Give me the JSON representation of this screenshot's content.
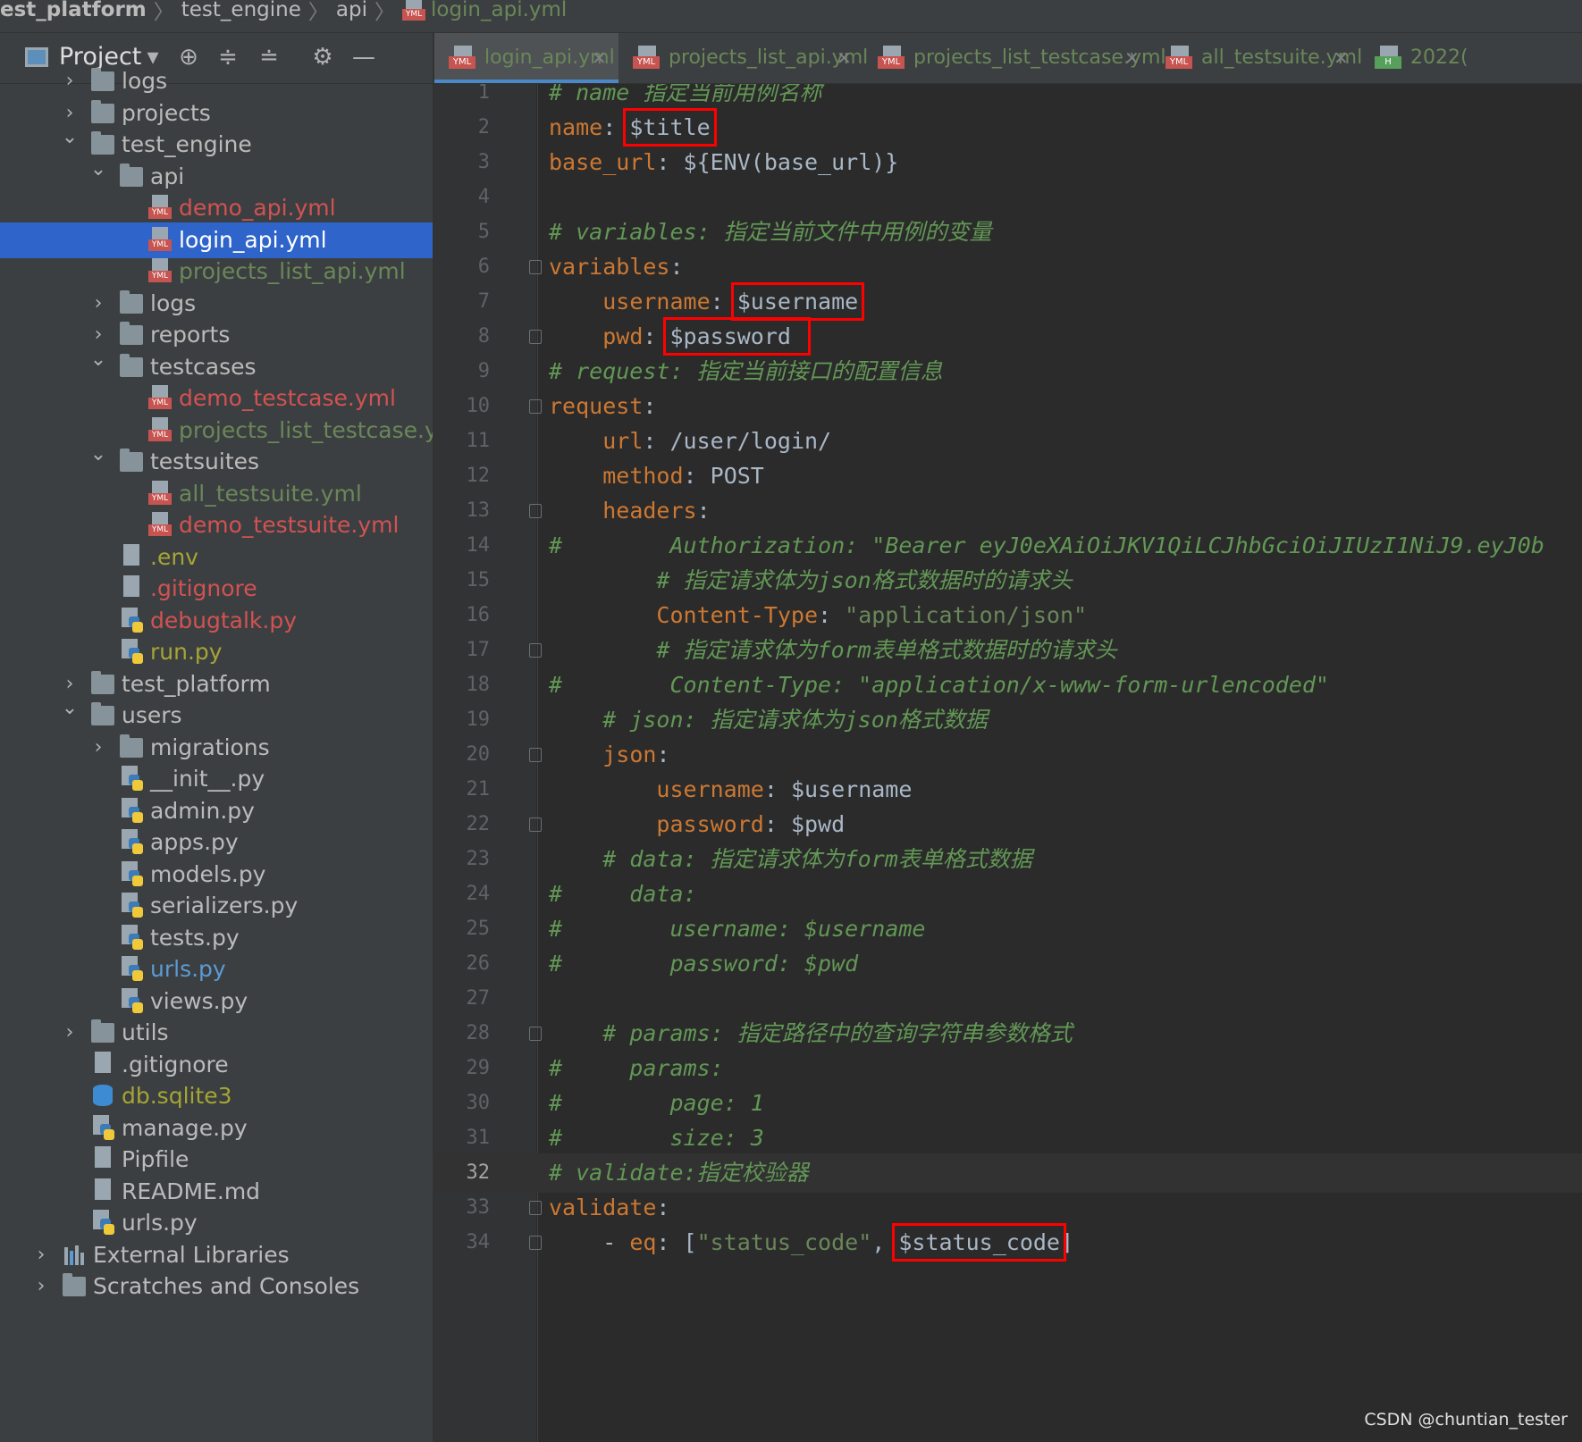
{
  "breadcrumb": [
    "est_platform",
    "test_engine",
    "api",
    "login_api.yml"
  ],
  "project_panel": {
    "title": "Project",
    "header_icons": [
      "dropdown-icon",
      "locate-icon",
      "expand-all-icon",
      "collapse-all-icon",
      "gear-icon",
      "minimize-icon"
    ]
  },
  "tree": [
    {
      "label": "logs",
      "type": "folder",
      "depth": 1,
      "expanded": false,
      "color": "default"
    },
    {
      "label": "projects",
      "type": "folder",
      "depth": 1,
      "expanded": false,
      "color": "default"
    },
    {
      "label": "test_engine",
      "type": "folder",
      "depth": 1,
      "expanded": true,
      "color": "default"
    },
    {
      "label": "api",
      "type": "folder",
      "depth": 2,
      "expanded": true,
      "color": "default"
    },
    {
      "label": "demo_api.yml",
      "type": "yml",
      "depth": 3,
      "color": "red"
    },
    {
      "label": "login_api.yml",
      "type": "yml",
      "depth": 3,
      "color": "white",
      "selected": true
    },
    {
      "label": "projects_list_api.yml",
      "type": "yml",
      "depth": 3,
      "color": "green"
    },
    {
      "label": "logs",
      "type": "folder",
      "depth": 2,
      "expanded": false,
      "color": "default"
    },
    {
      "label": "reports",
      "type": "folder",
      "depth": 2,
      "expanded": false,
      "color": "default"
    },
    {
      "label": "testcases",
      "type": "folder",
      "depth": 2,
      "expanded": true,
      "color": "default"
    },
    {
      "label": "demo_testcase.yml",
      "type": "yml",
      "depth": 3,
      "color": "red"
    },
    {
      "label": "projects_list_testcase.y",
      "type": "yml",
      "depth": 3,
      "color": "green"
    },
    {
      "label": "testsuites",
      "type": "folder",
      "depth": 2,
      "expanded": true,
      "color": "default"
    },
    {
      "label": "all_testsuite.yml",
      "type": "yml",
      "depth": 3,
      "color": "green"
    },
    {
      "label": "demo_testsuite.yml",
      "type": "yml",
      "depth": 3,
      "color": "red"
    },
    {
      "label": ".env",
      "type": "txt",
      "depth": 2,
      "color": "olive"
    },
    {
      "label": ".gitignore",
      "type": "txt",
      "depth": 2,
      "color": "red"
    },
    {
      "label": "debugtalk.py",
      "type": "py",
      "depth": 2,
      "color": "red"
    },
    {
      "label": "run.py",
      "type": "py",
      "depth": 2,
      "color": "olive"
    },
    {
      "label": "test_platform",
      "type": "folder",
      "depth": 1,
      "expanded": false,
      "color": "default"
    },
    {
      "label": "users",
      "type": "folder",
      "depth": 1,
      "expanded": true,
      "color": "default"
    },
    {
      "label": "migrations",
      "type": "folder",
      "depth": 2,
      "expanded": false,
      "color": "default"
    },
    {
      "label": "__init__.py",
      "type": "py",
      "depth": 2,
      "color": "default"
    },
    {
      "label": "admin.py",
      "type": "py",
      "depth": 2,
      "color": "default"
    },
    {
      "label": "apps.py",
      "type": "py",
      "depth": 2,
      "color": "default"
    },
    {
      "label": "models.py",
      "type": "py",
      "depth": 2,
      "color": "default"
    },
    {
      "label": "serializers.py",
      "type": "py",
      "depth": 2,
      "color": "default"
    },
    {
      "label": "tests.py",
      "type": "py",
      "depth": 2,
      "color": "default"
    },
    {
      "label": "urls.py",
      "type": "py",
      "depth": 2,
      "color": "blue"
    },
    {
      "label": "views.py",
      "type": "py",
      "depth": 2,
      "color": "default"
    },
    {
      "label": "utils",
      "type": "folder",
      "depth": 1,
      "expanded": false,
      "color": "default"
    },
    {
      "label": ".gitignore",
      "type": "txt",
      "depth": 1,
      "color": "default"
    },
    {
      "label": "db.sqlite3",
      "type": "db",
      "depth": 1,
      "color": "olive"
    },
    {
      "label": "manage.py",
      "type": "py",
      "depth": 1,
      "color": "default"
    },
    {
      "label": "Pipfile",
      "type": "txt",
      "depth": 1,
      "color": "default"
    },
    {
      "label": "README.md",
      "type": "txt",
      "depth": 1,
      "color": "default"
    },
    {
      "label": "urls.py",
      "type": "py",
      "depth": 1,
      "color": "default"
    },
    {
      "label": "External Libraries",
      "type": "lib",
      "depth": 0,
      "expanded": false,
      "color": "default"
    },
    {
      "label": "Scratches and Consoles",
      "type": "folder",
      "depth": 0,
      "expanded": false,
      "color": "default"
    }
  ],
  "tabs": [
    {
      "label": "login_api.yml",
      "icon": "YML",
      "active": true
    },
    {
      "label": "projects_list_api.yml",
      "icon": "YML",
      "active": false
    },
    {
      "label": "projects_list_testcase.yml",
      "icon": "YML",
      "active": false
    },
    {
      "label": "all_testsuite.yml",
      "icon": "YML",
      "active": false
    },
    {
      "label": "2022(",
      "icon": "H",
      "active": false
    }
  ],
  "editor": {
    "current_line": 32,
    "lines": [
      {
        "n": "1",
        "tokens": [
          [
            "cmt",
            "# name 指定当前用例名称"
          ]
        ]
      },
      {
        "n": "2",
        "tokens": [
          [
            "key",
            "name"
          ],
          [
            "plain",
            ": "
          ],
          [
            "val",
            "$title",
            "hl"
          ]
        ]
      },
      {
        "n": "3",
        "tokens": [
          [
            "key",
            "base_url"
          ],
          [
            "plain",
            ": "
          ],
          [
            "val",
            "${ENV(base_url)}"
          ]
        ]
      },
      {
        "n": "4",
        "tokens": []
      },
      {
        "n": "5",
        "tokens": [
          [
            "cmt",
            "# variables: 指定当前文件中用例的变量"
          ]
        ]
      },
      {
        "n": "6",
        "fold": true,
        "tokens": [
          [
            "key",
            "variables"
          ],
          [
            "plain",
            ":"
          ]
        ]
      },
      {
        "n": "7",
        "tokens": [
          [
            "plain",
            "    "
          ],
          [
            "key",
            "username"
          ],
          [
            "plain",
            ": "
          ],
          [
            "val",
            "$username",
            "hl"
          ]
        ]
      },
      {
        "n": "8",
        "fold": true,
        "tokens": [
          [
            "plain",
            "    "
          ],
          [
            "key",
            "pwd"
          ],
          [
            "plain",
            ": "
          ],
          [
            "val",
            "$password ",
            "hl"
          ]
        ]
      },
      {
        "n": "9",
        "tokens": [
          [
            "cmt",
            "# request: 指定当前接口的配置信息"
          ]
        ]
      },
      {
        "n": "10",
        "fold": true,
        "tokens": [
          [
            "key",
            "request"
          ],
          [
            "plain",
            ":"
          ]
        ]
      },
      {
        "n": "11",
        "tokens": [
          [
            "plain",
            "    "
          ],
          [
            "key",
            "url"
          ],
          [
            "plain",
            ": "
          ],
          [
            "val",
            "/user/login/"
          ]
        ]
      },
      {
        "n": "12",
        "tokens": [
          [
            "plain",
            "    "
          ],
          [
            "key",
            "method"
          ],
          [
            "plain",
            ": "
          ],
          [
            "val",
            "POST"
          ]
        ]
      },
      {
        "n": "13",
        "fold": true,
        "tokens": [
          [
            "plain",
            "    "
          ],
          [
            "key",
            "headers"
          ],
          [
            "plain",
            ":"
          ]
        ]
      },
      {
        "n": "14",
        "tokens": [
          [
            "cmt",
            "#        Authorization: \"Bearer eyJ0eXAiOiJKV1QiLCJhbGciOiJIUzI1NiJ9.eyJ0b"
          ]
        ]
      },
      {
        "n": "15",
        "tokens": [
          [
            "plain",
            "        "
          ],
          [
            "cmt",
            "# 指定请求体为json格式数据时的请求头"
          ]
        ]
      },
      {
        "n": "16",
        "tokens": [
          [
            "plain",
            "        "
          ],
          [
            "key",
            "Content-Type"
          ],
          [
            "plain",
            ": "
          ],
          [
            "str",
            "\"application/json\""
          ]
        ]
      },
      {
        "n": "17",
        "fold": true,
        "tokens": [
          [
            "plain",
            "        "
          ],
          [
            "cmt",
            "# 指定请求体为form表单格式数据时的请求头"
          ]
        ]
      },
      {
        "n": "18",
        "tokens": [
          [
            "cmt",
            "#        Content-Type: \"application/x-www-form-urlencoded\""
          ]
        ]
      },
      {
        "n": "19",
        "tokens": [
          [
            "plain",
            "    "
          ],
          [
            "cmt",
            "# json: 指定请求体为json格式数据"
          ]
        ]
      },
      {
        "n": "20",
        "fold": true,
        "tokens": [
          [
            "plain",
            "    "
          ],
          [
            "key",
            "json"
          ],
          [
            "plain",
            ":"
          ]
        ]
      },
      {
        "n": "21",
        "tokens": [
          [
            "plain",
            "        "
          ],
          [
            "key",
            "username"
          ],
          [
            "plain",
            ": "
          ],
          [
            "val",
            "$username"
          ]
        ]
      },
      {
        "n": "22",
        "fold": true,
        "tokens": [
          [
            "plain",
            "        "
          ],
          [
            "key",
            "password"
          ],
          [
            "plain",
            ": "
          ],
          [
            "val",
            "$pwd"
          ]
        ]
      },
      {
        "n": "23",
        "tokens": [
          [
            "plain",
            "    "
          ],
          [
            "cmt",
            "# data: 指定请求体为form表单格式数据"
          ]
        ]
      },
      {
        "n": "24",
        "tokens": [
          [
            "cmt",
            "#     data:"
          ]
        ]
      },
      {
        "n": "25",
        "tokens": [
          [
            "cmt",
            "#        username: $username"
          ]
        ]
      },
      {
        "n": "26",
        "tokens": [
          [
            "cmt",
            "#        password: $pwd"
          ]
        ]
      },
      {
        "n": "27",
        "tokens": []
      },
      {
        "n": "28",
        "fold": true,
        "tokens": [
          [
            "plain",
            "    "
          ],
          [
            "cmt",
            "# params: 指定路径中的查询字符串参数格式"
          ]
        ]
      },
      {
        "n": "29",
        "tokens": [
          [
            "cmt",
            "#     params:"
          ]
        ]
      },
      {
        "n": "30",
        "tokens": [
          [
            "cmt",
            "#        page: 1"
          ]
        ]
      },
      {
        "n": "31",
        "tokens": [
          [
            "cmt",
            "#        size: 3"
          ]
        ]
      },
      {
        "n": "32",
        "tokens": [
          [
            "cmt",
            "# validate:指定校验器"
          ]
        ]
      },
      {
        "n": "33",
        "fold": true,
        "tokens": [
          [
            "key",
            "validate"
          ],
          [
            "plain",
            ":"
          ]
        ]
      },
      {
        "n": "34",
        "fold": true,
        "tokens": [
          [
            "plain",
            "    - "
          ],
          [
            "key",
            "eq"
          ],
          [
            "plain",
            ": ["
          ],
          [
            "str",
            "\"status_code\""
          ],
          [
            "plain",
            ", "
          ],
          [
            "val",
            "$status_code",
            "hl"
          ],
          [
            "plain",
            "]"
          ]
        ]
      }
    ]
  },
  "watermark": "CSDN @chuntian_tester",
  "colors": {
    "selection": "#2f65ca",
    "highlight_box": "#ff0000",
    "keyword": "#cc7832",
    "comment": "#629755",
    "string": "#6a8759"
  }
}
